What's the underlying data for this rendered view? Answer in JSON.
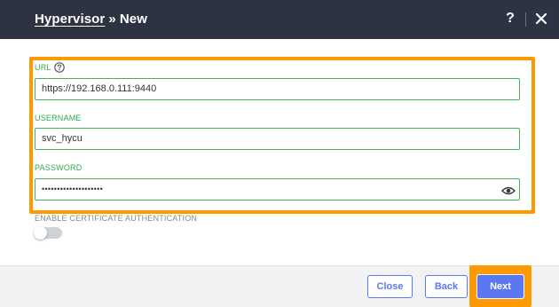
{
  "dialog": {
    "title_crumb": "Hypervisor",
    "title_separator": "»",
    "title_page": "New",
    "help_label": "?",
    "help_icon": "question-mark-icon",
    "close_icon": "close-x-icon"
  },
  "form": {
    "url": {
      "label": "URL",
      "value": "https://192.168.0.111:9440",
      "help_icon": "circle-question-icon"
    },
    "username": {
      "label": "USERNAME",
      "value": "svc_hycu"
    },
    "password": {
      "label": "PASSWORD",
      "masked_value": "••••••••••••••••••••",
      "reveal_icon": "eye-icon"
    },
    "certificate": {
      "label": "ENABLE CERTIFICATE AUTHENTICATION",
      "enabled": false
    }
  },
  "footer": {
    "close_label": "Close",
    "back_label": "Back",
    "next_label": "Next"
  },
  "colors": {
    "title_bar": "#2d3342",
    "highlight": "#ff9900",
    "field_border": "#43b45c",
    "label_green": "#31a94e",
    "primary_button": "#5b78f0"
  }
}
